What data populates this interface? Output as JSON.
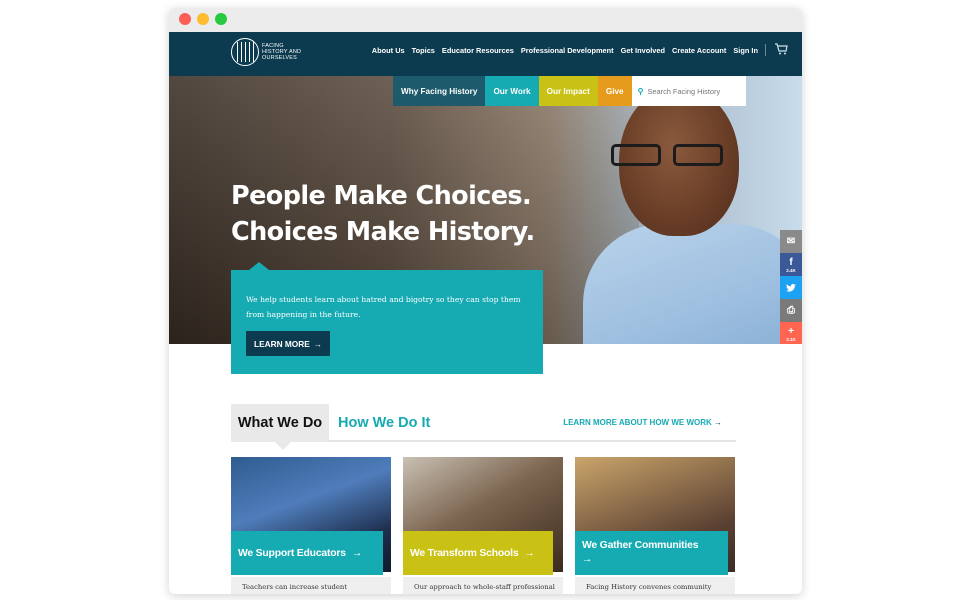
{
  "header": {
    "logo_text": "Facing History and Ourselves",
    "nav": [
      "About Us",
      "Topics",
      "Educator Resources",
      "Professional Development",
      "Get Involved",
      "Create Account",
      "Sign In"
    ]
  },
  "subnav": {
    "why": "Why Facing History",
    "work": "Our Work",
    "impact": "Our Impact",
    "give": "Give",
    "search_placeholder": "Search Facing History"
  },
  "hero": {
    "headline_line1": "People Make Choices.",
    "headline_line2": "Choices Make History.",
    "blurb": "We help students learn about hatred and bigotry so they can stop them from happening in the future.",
    "learn_more": "LEARN MORE"
  },
  "share": {
    "fb_count": "2.4K",
    "plus_count": "3.1K"
  },
  "section": {
    "tab_active": "What We Do",
    "tab_other": "How We Do It",
    "learn_link": "LEARN MORE ABOUT HOW WE WORK"
  },
  "cards": [
    {
      "label": "We Support Educators",
      "desc": "Teachers can increase student"
    },
    {
      "label": "We Transform Schools",
      "desc": "Our approach to whole-staff professional"
    },
    {
      "label": "We Gather Communities",
      "desc": "Facing History convenes community"
    }
  ],
  "colors": {
    "navy": "#0c3b4f",
    "teal": "#16aab2",
    "yellow": "#c9c215",
    "orange": "#e79b1d"
  }
}
